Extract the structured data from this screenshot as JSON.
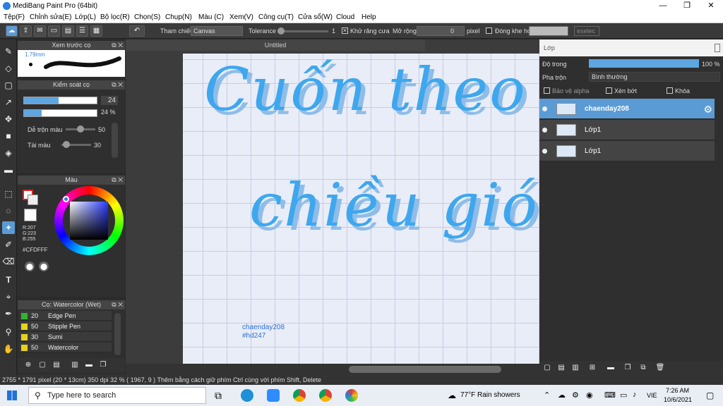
{
  "window": {
    "title": "MediBang Paint Pro (64bit)"
  },
  "menu": [
    "Tệp(F)",
    "Chỉnh sửa(E)",
    "Lớp(L)",
    "Bộ lọc(R)",
    "Chọn(S)",
    "Chụp(N)",
    "Màu (C)",
    "Xem(V)",
    "Công cụ(T)",
    "Cửa sổ(W)",
    "Cloud",
    "Help"
  ],
  "toolbar": {
    "ref_label": "Tham chiếu",
    "ref_value": "Canvas",
    "tolerance_label": "Tolerance",
    "tolerance_value": "1",
    "antialias_label": "Khử răng cưa",
    "expand_label": "Mở rộng",
    "expand_value": "0",
    "expand_unit": "pixel",
    "close_gap_label": "Đóng khe hở",
    "select_label": "eselec"
  },
  "brush_preview": {
    "title": "Xem trước cọ",
    "size": "1.79mm"
  },
  "brush_control": {
    "title": "Kiểm soát cọ",
    "size_value": "24",
    "opacity_value": "24 %",
    "blend_label": "Dễ trộn màu",
    "blend_value": "50",
    "color_amount_label": "Tài màu",
    "color_amount_value": "30"
  },
  "color": {
    "title": "Màu",
    "r": "R:207",
    "g": "G:223",
    "b": "B:255",
    "hex": "#CFDFFF"
  },
  "brush_list": {
    "title": "Cọ: Watercolor (Wet)",
    "items": [
      {
        "size": "20",
        "name": "Edge Pen",
        "color": "#2fb52f"
      },
      {
        "size": "50",
        "name": "Stipple Pen",
        "color": "#e5d21a"
      },
      {
        "size": "30",
        "name": "Sumi",
        "color": "#e5d21a"
      },
      {
        "size": "50",
        "name": "Watercolor",
        "color": "#e5d21a"
      }
    ]
  },
  "document": {
    "tab_title": "Untitled",
    "line1": "Cuốn theo",
    "line2": "chiều gió",
    "signature1": "chaenday208",
    "signature2": "#hd247"
  },
  "layers": {
    "title": "Lớp",
    "opacity_label": "Độ trong",
    "opacity_value": "100 %",
    "blend_label": "Pha trộn",
    "blend_value": "Bình thường",
    "protect_alpha": "Bảo vệ alpha",
    "clipping": "Xén bớt",
    "lock": "Khóa",
    "items": [
      {
        "name": "chaenday208",
        "selected": true
      },
      {
        "name": "Lớp1",
        "selected": false
      },
      {
        "name": "Lớp1",
        "selected": false
      }
    ]
  },
  "status": {
    "text": "2755 * 1791 pixel  (20 * 13cm)  350 dpi  32 %  ( 1967, 9 )  Thêm bằng cách giữ phím Ctrl cùng với phím Shift, Delete"
  },
  "taskbar": {
    "search_placeholder": "Type here to search",
    "weather": "77°F  Rain showers",
    "lang": "VIE",
    "time": "7:26 AM",
    "date": "10/6/2021"
  }
}
